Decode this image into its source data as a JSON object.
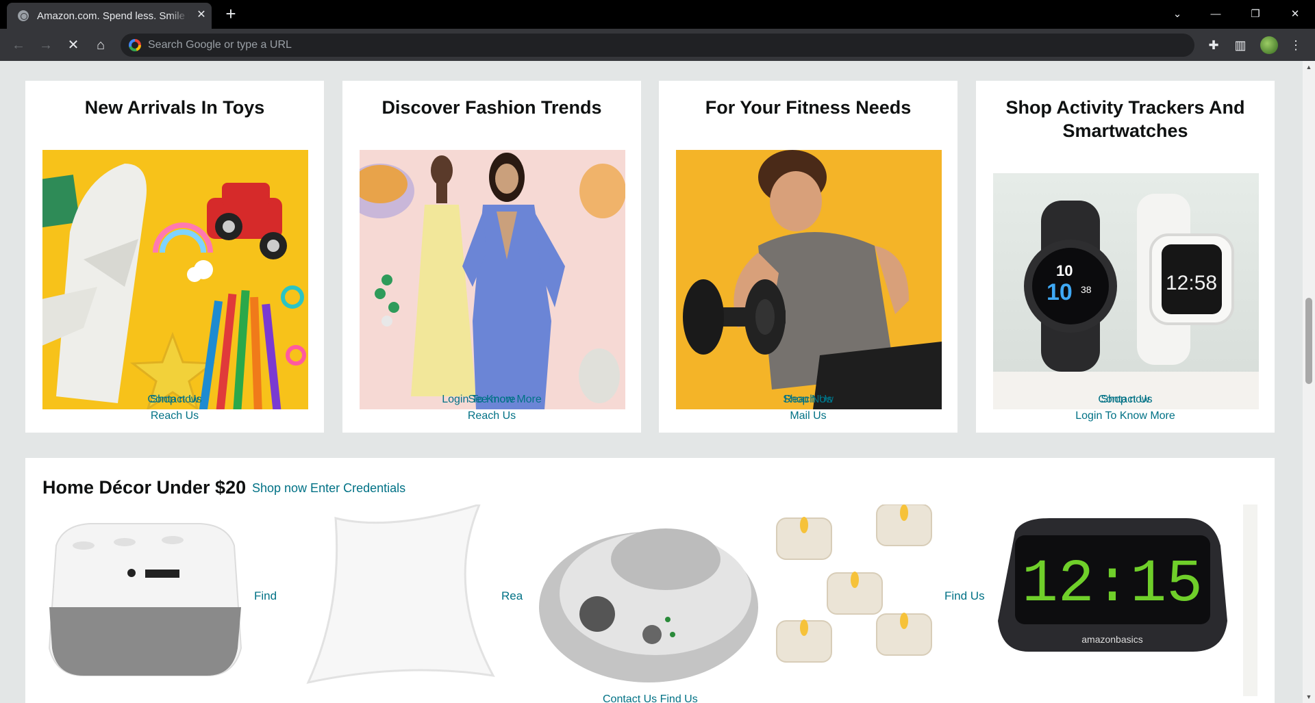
{
  "browser": {
    "tab_title": "Amazon.com. Spend less. Smile more.",
    "new_tab_symbol": "+",
    "tab_close_symbol": "✕",
    "omnibox_placeholder": "Search Google or type a URL"
  },
  "cards": [
    {
      "title": "New Arrivals In Toys",
      "overlap_links": [
        "Contact Us",
        "Shop now"
      ],
      "link": "Reach Us"
    },
    {
      "title": "Discover Fashion Trends",
      "overlap_links": [
        "Login To Know More",
        "See more"
      ],
      "link": "Reach Us"
    },
    {
      "title": "For Your Fitness Needs",
      "overlap_links": [
        "Shop Now",
        "Reach Us"
      ],
      "link": "Mail Us"
    },
    {
      "title": "Shop Activity Trackers And Smartwatches",
      "overlap_links": [
        "Contact Us",
        "Shop now"
      ],
      "link": "Login To Know More"
    }
  ],
  "home_decor": {
    "title": "Home Décor Under $20",
    "shop_link": "Shop now Enter Credentials",
    "item_links": [
      "Find",
      "Rea",
      "Find Us"
    ],
    "clock_time": "12:15",
    "clock_brand": "amazonbasics",
    "bottom_links": "Contact Us Find Us"
  },
  "watch_faces": {
    "left_top": "10",
    "left_big": "10",
    "left_small": "38",
    "right_big": "12:58"
  },
  "colors": {
    "link": "#007185",
    "page_bg": "#e3e6e6",
    "card_bg": "#ffffff"
  }
}
